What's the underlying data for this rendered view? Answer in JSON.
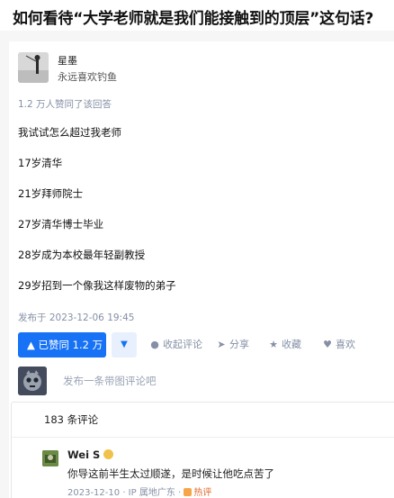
{
  "question": {
    "title": "如何看待“大学老师就是我们能接触到的顶层”这句话?"
  },
  "author": {
    "name": "星墨",
    "bio": "永远喜欢钓鱼"
  },
  "upvote_note": "1.2 万人赞同了该回答",
  "answer": {
    "lines": [
      "我试试怎么超过我老师",
      "17岁清华",
      "21岁拜师院士",
      "27岁清华博士毕业",
      "28岁成为本校最年轻副教授",
      "29岁招到一个像我这样废物的弟子"
    ]
  },
  "publish_time": "发布于 2023-12-06 19:45",
  "actions": {
    "upvote_label": "▲ 已赞同 1.2 万",
    "downvote_label": "▼",
    "collapse_comments": "收起评论",
    "share": "分享",
    "favorite": "收藏",
    "like": "喜欢"
  },
  "compose": {
    "placeholder": "发布一条带图评论吧"
  },
  "comments": {
    "count_label": "183 条评论",
    "items": [
      {
        "user": "Wei S",
        "text": "你导这前半生太过顺遂，是时候让他吃点苦了",
        "date": "2023-12-10",
        "location": "IP 属地广东",
        "hot_label": "热评"
      }
    ]
  }
}
